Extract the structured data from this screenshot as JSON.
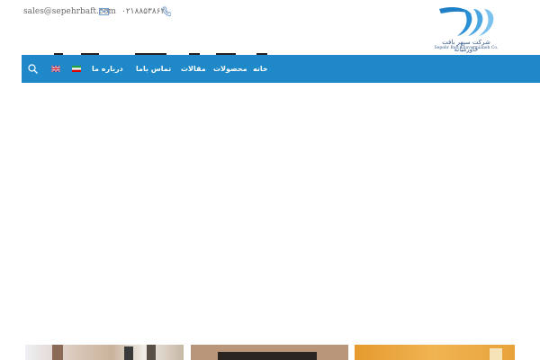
{
  "header": {
    "email": "sales@sepehrbaft.com",
    "phone": "۰۲۱۸۸۵۳۸۶۲۰",
    "logo": {
      "company_name_fa": "شرکت سپهر بافت خاورمیانه",
      "company_name_en": "Sepehr Baft Khavarmianeh Co."
    }
  },
  "nav": {
    "items": [
      {
        "label": "خانه"
      },
      {
        "label": "محصولات"
      },
      {
        "label": "مقالات"
      },
      {
        "label": "تماس باما"
      },
      {
        "label": "درباره ما"
      }
    ],
    "languages": [
      "fa",
      "en"
    ]
  },
  "colors": {
    "nav_bg": "#1e88c8",
    "logo_blue": "#2a8fd4"
  }
}
